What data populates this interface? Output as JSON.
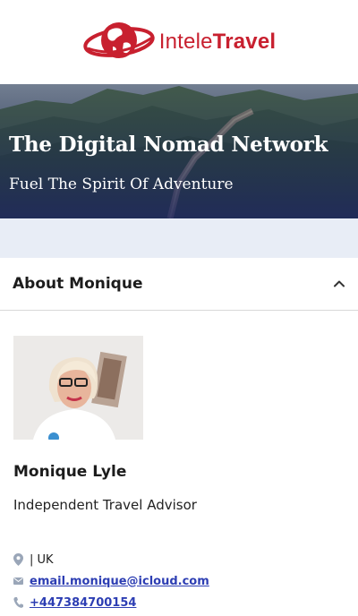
{
  "brand": {
    "logo_light": "Intele",
    "logo_bold": "Travel",
    "color": "#c8202f"
  },
  "hero": {
    "title": "The Digital Nomad Network",
    "subtitle": "Fuel The Spirit Of Adventure"
  },
  "about": {
    "heading": "About Monique",
    "toggle_icon": "chevron-up-icon"
  },
  "profile": {
    "name": "Monique Lyle",
    "role": "Independent Travel Advisor"
  },
  "contacts": {
    "location": "| UK",
    "email": "email.monique@icloud.com",
    "phone": "+447384700154",
    "link_color": "#2d3eb3"
  }
}
